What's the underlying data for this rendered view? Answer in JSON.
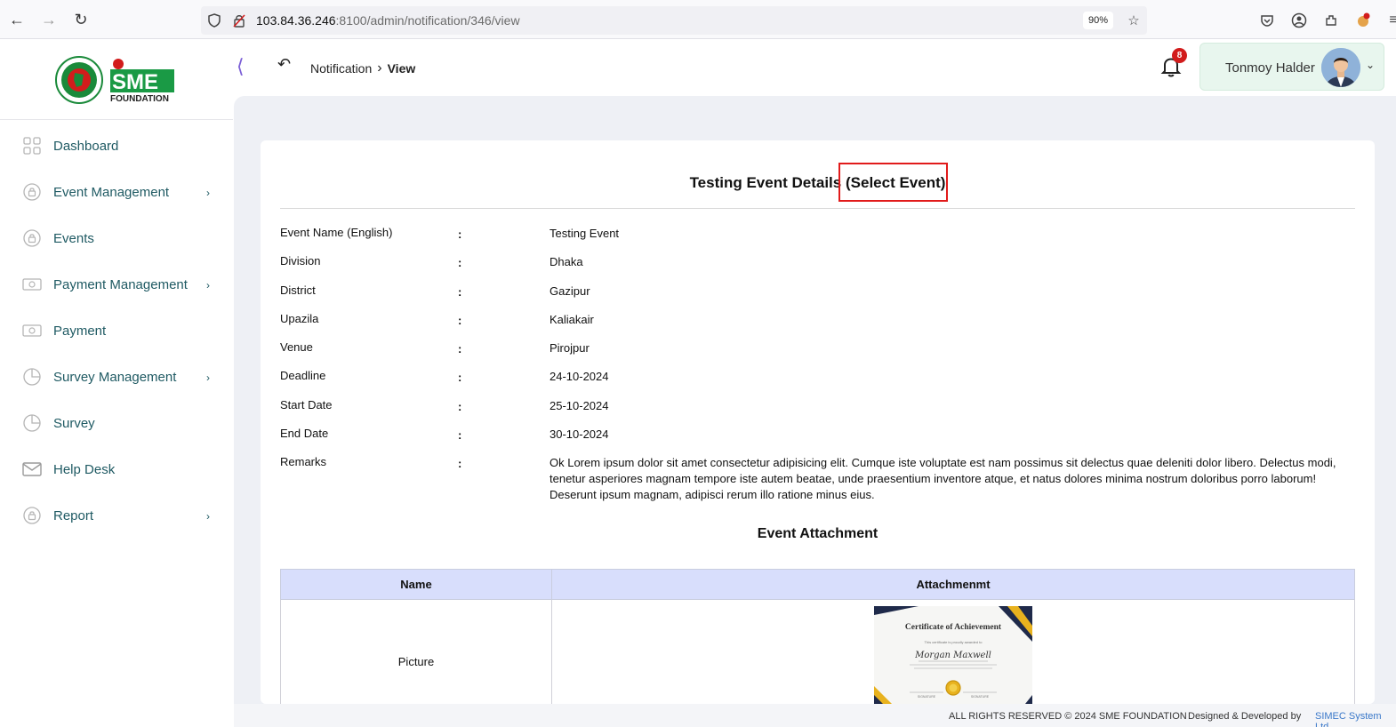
{
  "browser": {
    "url_host": "103.84.36.246",
    "url_rest": ":8100/admin/notification/346/view",
    "zoom": "90%"
  },
  "header": {
    "logo_text": "SME",
    "logo_sub": "FOUNDATION",
    "breadcrumb_parent": "Notification",
    "breadcrumb_current": "View",
    "notification_count": "8",
    "user_name": "Tonmoy Halder"
  },
  "sidebar": {
    "items": [
      {
        "label": "Dashboard",
        "icon": "grid-icon",
        "has_submenu": false
      },
      {
        "label": "Event Management",
        "icon": "lock-circle-icon",
        "has_submenu": true
      },
      {
        "label": "Events",
        "icon": "lock-circle-icon",
        "has_submenu": false
      },
      {
        "label": "Payment Management",
        "icon": "money-icon",
        "has_submenu": true
      },
      {
        "label": "Payment",
        "icon": "money-icon",
        "has_submenu": false
      },
      {
        "label": "Survey Management",
        "icon": "pie-chart-icon",
        "has_submenu": true
      },
      {
        "label": "Survey",
        "icon": "pie-chart-icon",
        "has_submenu": false
      },
      {
        "label": "Help Desk",
        "icon": "mail-icon",
        "has_submenu": false
      },
      {
        "label": "Report",
        "icon": "lock-circle-icon",
        "has_submenu": true
      }
    ],
    "caret": "›"
  },
  "main": {
    "title_prefix": "Testing Event Details",
    "title_highlight": "(Select Event)",
    "colon": ":",
    "details": [
      {
        "label": "Event Name (English)",
        "value": "Testing Event"
      },
      {
        "label": "Division",
        "value": "Dhaka"
      },
      {
        "label": "District",
        "value": "Gazipur"
      },
      {
        "label": "Upazila",
        "value": "Kaliakair"
      },
      {
        "label": "Venue",
        "value": "Pirojpur"
      },
      {
        "label": "Deadline",
        "value": "24-10-2024"
      },
      {
        "label": "Start Date",
        "value": "25-10-2024"
      },
      {
        "label": "End Date",
        "value": "30-10-2024"
      },
      {
        "label": "Remarks",
        "value": "Ok Lorem ipsum dolor sit amet consectetur adipisicing elit. Cumque iste voluptate est nam possimus sit delectus quae deleniti dolor libero. Delectus modi, tenetur asperiores magnam tempore iste autem beatae, unde praesentium inventore atque, et natus dolores minima nostrum doloribus porro laborum! Deserunt ipsum magnam, adipisci rerum illo ratione minus eius."
      }
    ],
    "attachment_title": "Event Attachment",
    "table_headers": [
      "Name",
      "Attachmenmt"
    ],
    "table_rows": [
      {
        "name": "Picture"
      }
    ],
    "certificate": {
      "title": "Certificate of Achievement",
      "line": "This certificate is proudly awarded to",
      "name": "Morgan Maxwell",
      "sig_left": "SIGNATURE",
      "sig_right": "SIGNATURE"
    }
  },
  "footer": {
    "rights": "ALL RIGHTS RESERVED © 2024 SME FOUNDATION",
    "designed": "Designed & Developed by",
    "company": "SIMEC System Ltd"
  },
  "colors": {
    "sidebar_text": "#1f5a63",
    "highlight_border": "#e11b1b",
    "table_header_bg": "#d8defc",
    "badge": "#d21c1c",
    "user_box": "#e8f6ee"
  }
}
